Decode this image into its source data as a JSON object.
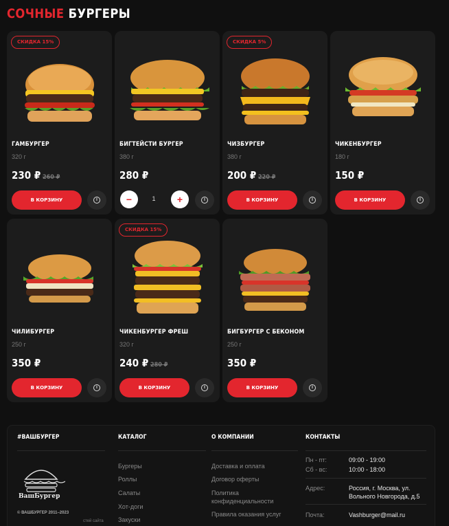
{
  "section": {
    "title_red": "СОЧНЫЕ",
    "title_white": "БУРГЕРЫ"
  },
  "currency": "₽",
  "buttons": {
    "cart": "В КОРЗИНУ",
    "info": "i",
    "minus": "−",
    "plus": "+"
  },
  "products": [
    {
      "name": "ГАМБУРГЕР",
      "weight": "320 г",
      "price": "230 ₽",
      "old_price": "260 ₽",
      "badge": "СКИДКА 15%"
    },
    {
      "name": "БИГТЕЙСТИ БУРГЕР",
      "weight": "380 г",
      "price": "280 ₽",
      "old_price": "",
      "badge": "",
      "quantity": "1"
    },
    {
      "name": "ЧИЗБУРГЕР",
      "weight": "380 г",
      "price": "200 ₽",
      "old_price": "220 ₽",
      "badge": "СКИДКА 5%"
    },
    {
      "name": "ЧИКЕНБУРГЕР",
      "weight": "180 г",
      "price": "150 ₽",
      "old_price": "",
      "badge": ""
    },
    {
      "name": "ЧИЛИБУРГЕР",
      "weight": "250 г",
      "price": "350 ₽",
      "old_price": "",
      "badge": ""
    },
    {
      "name": "ЧИКЕНБУРГЕР ФРЕШ",
      "weight": "320 г",
      "price": "240 ₽",
      "old_price": "280 ₽",
      "badge": "СКИДКА 15%"
    },
    {
      "name": "БИГБУРГЕР С БЕКОНОМ",
      "weight": "250 г",
      "price": "350 ₽",
      "old_price": "",
      "badge": ""
    }
  ],
  "footer": {
    "brand_title": "#ВАШБУРГЕР",
    "logo_text": "ВашБургер",
    "copyright": "© ВАШБУРГЕР 2011–2023",
    "copyright_sub": "стей сайта",
    "catalog_title": "КАТАЛОГ",
    "catalog_links": [
      "Бургеры",
      "Роллы",
      "Салаты",
      "Хот-доги",
      "Закуски"
    ],
    "company_title": "О КОМПАНИИ",
    "company_links": [
      "Доставка и оплата",
      "Договор оферты",
      "Политика конфиденциальности",
      "Правила оказания услуг"
    ],
    "contacts_title": "КОНТАКТЫ",
    "hours_label_1": "Пн - пт:",
    "hours_value_1": "09:00 - 19:00",
    "hours_label_2": "Сб - вс:",
    "hours_value_2": "10:00 - 18:00",
    "address_label": "Адрес:",
    "address_value": "Россия, г. Москва, ул. Вольного Новгорода, д.5",
    "email_label": "Почта:",
    "email_value": "Vashburger@mail.ru"
  },
  "colors": {
    "accent": "#e3262e",
    "background": "#101010",
    "card": "#1c1c1c"
  }
}
